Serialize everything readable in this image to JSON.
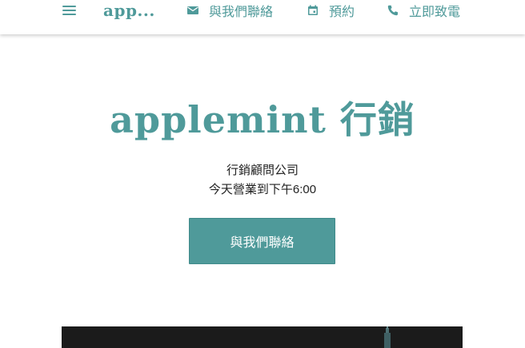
{
  "header": {
    "brand": "app...",
    "menu_icon": "hamburger-menu-icon",
    "links": [
      {
        "label": "與我們聯絡",
        "icon": "mail-icon"
      },
      {
        "label": "預約",
        "icon": "calendar-icon"
      },
      {
        "label": "立即致電",
        "icon": "phone-icon"
      }
    ]
  },
  "hero": {
    "title": "applemint 行銷",
    "subtitle": "行銷顧問公司",
    "hours": "今天營業到下午6:00",
    "cta_label": "與我們聯絡"
  },
  "colors": {
    "accent": "#4f9a9a",
    "text": "#222222",
    "background": "#ffffff",
    "image_dark": "#1b1b1b"
  }
}
